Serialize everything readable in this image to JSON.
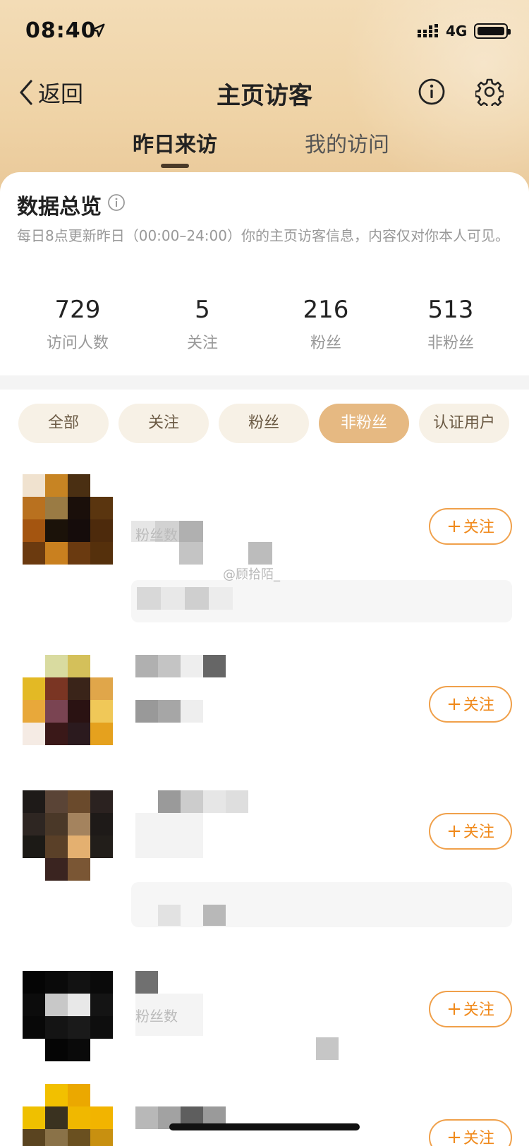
{
  "status_bar": {
    "time": "08:40",
    "network": "4G"
  },
  "nav": {
    "back_label": "返回",
    "title": "主页访客"
  },
  "tabs": [
    {
      "label": "昨日来访",
      "active": true
    },
    {
      "label": "我的访问",
      "active": false
    }
  ],
  "overview": {
    "title": "数据总览",
    "description": "每日8点更新昨日（00:00–24:00）你的主页访客信息，内容仅对你本人可见。",
    "stats": [
      {
        "value": "729",
        "label": "访问人数"
      },
      {
        "value": "5",
        "label": "关注"
      },
      {
        "value": "216",
        "label": "粉丝"
      },
      {
        "value": "513",
        "label": "非粉丝"
      }
    ]
  },
  "filters": [
    {
      "label": "全部",
      "active": false
    },
    {
      "label": "关注",
      "active": false
    },
    {
      "label": "粉丝",
      "active": false
    },
    {
      "label": "非粉丝",
      "active": true
    },
    {
      "label": "认证用户",
      "active": false
    }
  ],
  "visitors": [
    {
      "follow_label": "关注",
      "detail_text": "粉丝数"
    },
    {
      "follow_label": "关注"
    },
    {
      "follow_label": "关注"
    },
    {
      "follow_label": "关注",
      "detail_text": "粉丝数"
    },
    {
      "follow_label": "关注"
    }
  ],
  "watermark": "@顾拾陌_",
  "colors": {
    "accent_orange": "#f08a1c",
    "active_chip": "#e6b982",
    "header_gold": "#efd3a6"
  }
}
